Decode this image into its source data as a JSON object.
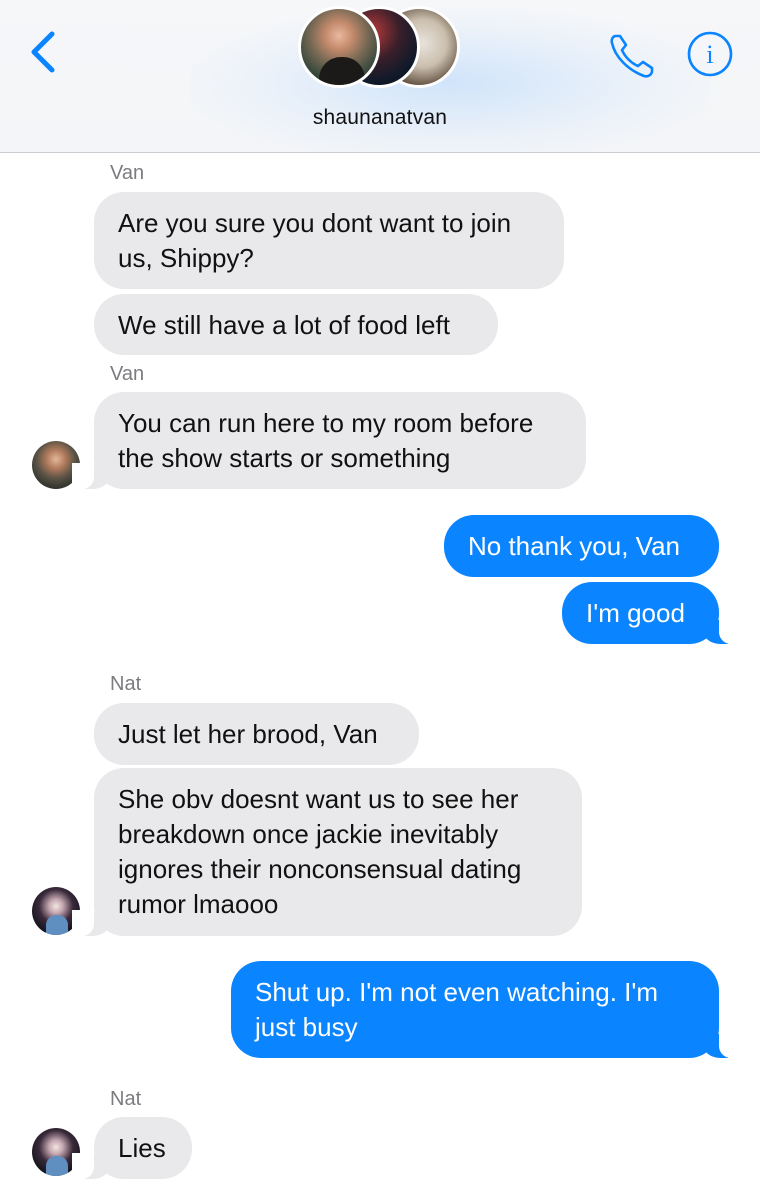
{
  "header": {
    "group_name": "shaunanatvan",
    "back_icon": "chevron-left-icon",
    "call_icon": "phone-icon",
    "info_icon": "info-icon",
    "accent_color": "#0a84ff"
  },
  "messages": [
    {
      "type": "sender",
      "text": "Van"
    },
    {
      "type": "received",
      "text": "Are you sure you dont want to join us, Shippy?"
    },
    {
      "type": "received",
      "text": "We still have a lot of food left"
    },
    {
      "type": "sender",
      "text": "Van"
    },
    {
      "type": "received",
      "text": "You can run here to my room before the show starts or something"
    },
    {
      "type": "sent",
      "text": "No thank you, Van"
    },
    {
      "type": "sent",
      "text": "I'm good"
    },
    {
      "type": "sender",
      "text": "Nat"
    },
    {
      "type": "received",
      "text": "Just let her brood, Van"
    },
    {
      "type": "received",
      "text": "She obv doesnt want us to see her breakdown once jackie inevitably ignores their nonconsensual dating rumor lmaooo"
    },
    {
      "type": "sent",
      "text": "Shut up. I'm not even watching. I'm just busy"
    },
    {
      "type": "sender",
      "text": "Nat"
    },
    {
      "type": "received",
      "text": "Lies"
    }
  ],
  "colors": {
    "received_bubble": "#e9e9eb",
    "sent_bubble": "#0a84ff",
    "sender_label": "#7c7c80"
  }
}
